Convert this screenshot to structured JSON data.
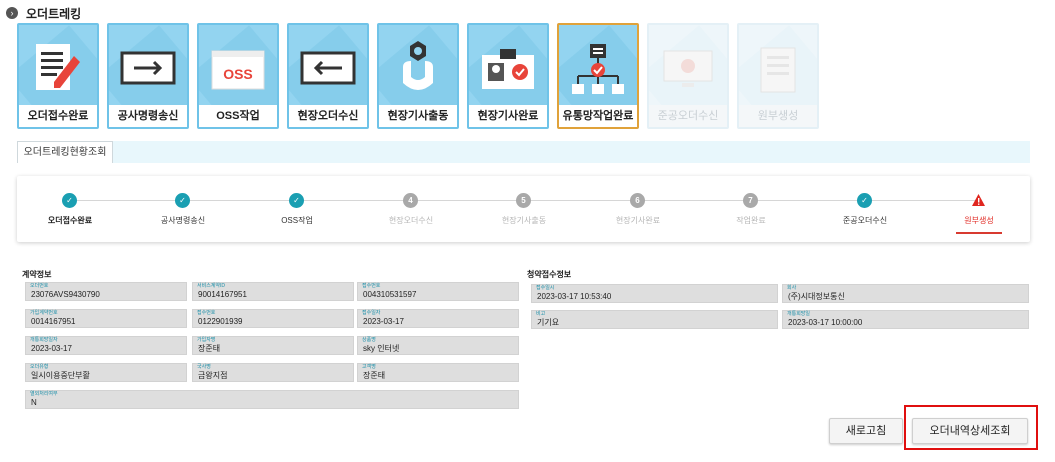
{
  "header": {
    "title": "오더트레킹"
  },
  "cards": [
    {
      "label": "오더접수완료",
      "icon": "document-pencil-icon"
    },
    {
      "label": "공사명령송신",
      "icon": "arrow-right-box-icon"
    },
    {
      "label": "OSS작업",
      "icon": "oss-window-icon",
      "icon_text": "OSS"
    },
    {
      "label": "현장오더수신",
      "icon": "arrow-left-box-icon"
    },
    {
      "label": "현장기사출동",
      "icon": "wrench-icon"
    },
    {
      "label": "현장기사완료",
      "icon": "id-badge-check-icon"
    },
    {
      "label": "유통망작업완료",
      "icon": "network-check-icon"
    },
    {
      "label": "준공오더수신",
      "icon": "monitor-check-icon"
    },
    {
      "label": "원부생성",
      "icon": "checklist-icon"
    }
  ],
  "tab": {
    "label": "오더트레킹현황조회"
  },
  "steps": [
    {
      "label": "오더접수완료",
      "status": "done",
      "bold": true
    },
    {
      "label": "공사명령송신",
      "status": "done"
    },
    {
      "label": "OSS작업",
      "status": "done"
    },
    {
      "label": "현장오더수신",
      "status": "pending",
      "num": "4"
    },
    {
      "label": "현장기사출동",
      "status": "pending",
      "num": "5"
    },
    {
      "label": "현장기사완료",
      "status": "pending",
      "num": "6"
    },
    {
      "label": "작업완료",
      "status": "pending",
      "num": "7"
    },
    {
      "label": "준공오더수신",
      "status": "done"
    },
    {
      "label": "원부생성",
      "status": "error"
    }
  ],
  "contract": {
    "title": "계약정보",
    "fields": [
      {
        "label": "오더번호",
        "value": "23076AVS9430790"
      },
      {
        "label": "서비스계약ID",
        "value": "90014167951"
      },
      {
        "label": "접수번호",
        "value": "004310531597"
      },
      {
        "label": "가입계약번호",
        "value": "0014167951"
      },
      {
        "label": "접수번호",
        "value": "0122901939"
      },
      {
        "label": "접수일자",
        "value": "2023-03-17"
      },
      {
        "label": "개통희망일자",
        "value": "2023-03-17"
      },
      {
        "label": "가입자명",
        "value": "장준태"
      },
      {
        "label": "상품명",
        "value": "sky 인터넷"
      },
      {
        "label": "오더유형",
        "value": "일시이용중단부활"
      },
      {
        "label": "국사명",
        "value": "금왕지점"
      },
      {
        "label": "고객명",
        "value": "장준태"
      },
      {
        "label": "열외처리여부",
        "value": "N"
      }
    ]
  },
  "request": {
    "title": "청약접수정보",
    "fields": [
      {
        "label": "접수일시",
        "value": "2023-03-17 10:53:40"
      },
      {
        "label": "회사",
        "value": "(주)시대정보통신"
      },
      {
        "label": "비고",
        "value": "기기요"
      },
      {
        "label": "개통희망일",
        "value": "2023-03-17 10:00:00"
      }
    ]
  },
  "buttons": {
    "refresh": "새로고침",
    "detail": "오더내역상세조회"
  },
  "colors": {
    "done": "#1a9fb2",
    "pending": "#a9a9a9",
    "error": "#d83a30",
    "card": "#93d4f0",
    "highlight": "#e00f0f"
  }
}
